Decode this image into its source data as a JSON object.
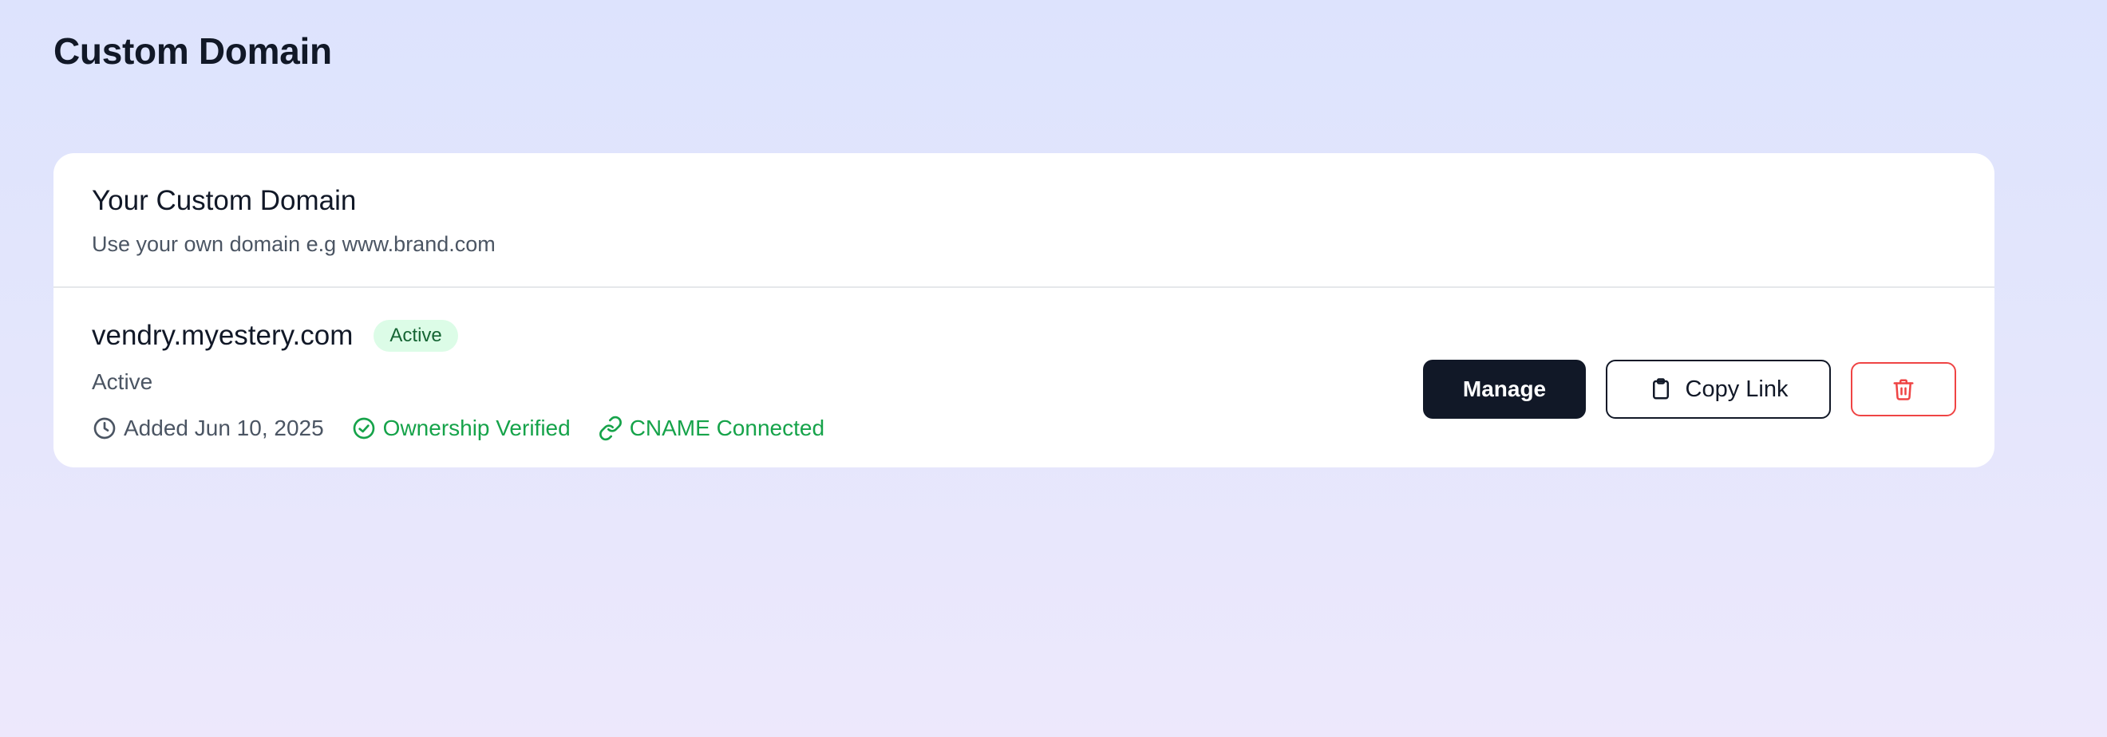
{
  "page": {
    "title": "Custom Domain"
  },
  "card": {
    "title": "Your Custom Domain",
    "subtitle": "Use your own domain e.g www.brand.com"
  },
  "domain": {
    "name": "vendry.myestery.com",
    "badge": "Active",
    "status": "Active",
    "added": "Added Jun 10, 2025",
    "ownership": "Ownership Verified",
    "cname": "CNAME Connected"
  },
  "actions": {
    "manage_label": "Manage",
    "copy_label": "Copy Link",
    "delete_icon": "trash-icon"
  },
  "colors": {
    "accent_dark": "#111827",
    "success": "#16a34a",
    "badge_bg": "#dcfce7",
    "danger": "#ef4444"
  }
}
